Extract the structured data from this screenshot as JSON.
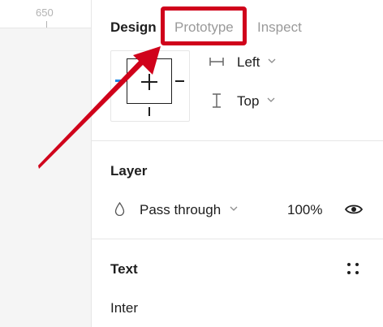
{
  "ruler": {
    "label": "650"
  },
  "tabs": [
    {
      "label": "Design",
      "active": true
    },
    {
      "label": "Prototype",
      "active": false
    },
    {
      "label": "Inspect",
      "active": false
    }
  ],
  "constraints": {
    "horizontal": "Left",
    "vertical": "Top"
  },
  "layer": {
    "title": "Layer",
    "blend_mode": "Pass through",
    "opacity": "100%"
  },
  "text_section": {
    "title": "Text",
    "font": "Inter"
  },
  "colors": {
    "highlight": "#d0021b",
    "accent": "#1e88e5"
  }
}
